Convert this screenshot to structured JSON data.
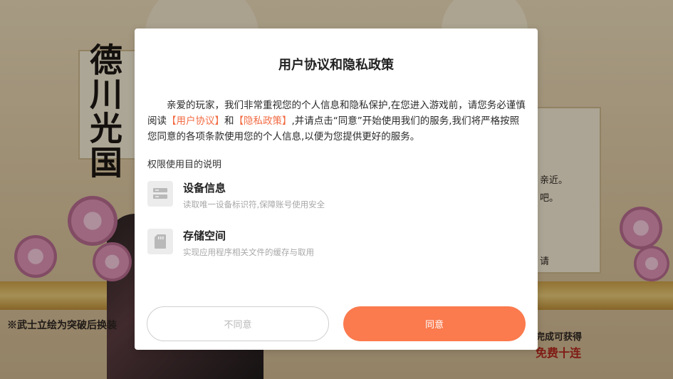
{
  "background": {
    "calligraphy": "德川光国",
    "left_note": "※武士立绘为突破后换装",
    "right_note": "完成可获得",
    "right_highlight": "免费十连",
    "side_lines": [
      "亲近。",
      "吧。",
      "请"
    ]
  },
  "dialog": {
    "title": "用户协议和隐私政策",
    "intro": {
      "part1": "亲爱的玩家，我们非常重视您的个人信息和隐私保护,在您进入游戏前，请您务必谨慎阅读",
      "link_user_agreement": "【用户协议】",
      "and": "和",
      "link_privacy_policy": "【隐私政策】",
      "part2": ",并请点击“同意”开始使用我们的服务,我们将严格按照您同意的各项条款使用您的个人信息,以便为您提供更好的服务。"
    },
    "permissions_heading": "权限使用目的说明",
    "permissions": [
      {
        "icon": "server-icon",
        "title": "设备信息",
        "description": "读取唯一设备标识符,保障账号使用安全"
      },
      {
        "icon": "sd-card-icon",
        "title": "存储空间",
        "description": "实现应用程序相关文件的缓存与取用"
      }
    ],
    "buttons": {
      "decline": "不同意",
      "agree": "同意"
    }
  },
  "colors": {
    "accent": "#fb7a4e",
    "link": "#f26b43"
  }
}
